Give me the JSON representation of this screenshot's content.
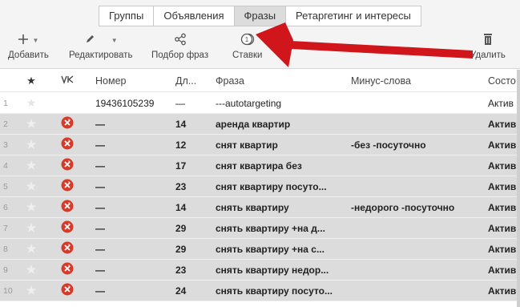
{
  "tabs": [
    {
      "label": "Группы",
      "active": false
    },
    {
      "label": "Объявления",
      "active": false
    },
    {
      "label": "Фразы",
      "active": true
    },
    {
      "label": "Ретаргетинг и интересы",
      "active": false
    }
  ],
  "toolbar": {
    "add_label": "Добавить",
    "edit_label": "Редактировать",
    "phrase_select_label": "Подбор фраз",
    "bids_label": "Ставки",
    "delete_label": "Удалить"
  },
  "columns": {
    "number": "Номер",
    "length": "Дл...",
    "phrase": "Фраза",
    "minus": "Минус-слова",
    "state": "Состо"
  },
  "rows": [
    {
      "n": "1",
      "status": "none",
      "number": "19436105239",
      "len": "—",
      "phrase": "---autotargeting",
      "minus": "",
      "state": "Актив"
    },
    {
      "n": "2",
      "status": "stopped",
      "number": "—",
      "len": "14",
      "phrase": "аренда квартир",
      "minus": "",
      "state": "Актив"
    },
    {
      "n": "3",
      "status": "stopped",
      "number": "—",
      "len": "12",
      "phrase": "снят квартир",
      "minus": "-без -посуточно",
      "state": "Актив"
    },
    {
      "n": "4",
      "status": "stopped",
      "number": "—",
      "len": "17",
      "phrase": "снят квартира без",
      "minus": "",
      "state": "Актив"
    },
    {
      "n": "5",
      "status": "stopped",
      "number": "—",
      "len": "23",
      "phrase": "снят квартиру посуто...",
      "minus": "",
      "state": "Актив"
    },
    {
      "n": "6",
      "status": "stopped",
      "number": "—",
      "len": "14",
      "phrase": "снять квартиру",
      "minus": "-недорого -посуточно",
      "state": "Актив"
    },
    {
      "n": "7",
      "status": "stopped",
      "number": "—",
      "len": "29",
      "phrase": "снять квартиру +на д...",
      "minus": "",
      "state": "Актив"
    },
    {
      "n": "8",
      "status": "stopped",
      "number": "—",
      "len": "29",
      "phrase": "снять квартиру +на с...",
      "minus": "",
      "state": "Актив"
    },
    {
      "n": "9",
      "status": "stopped",
      "number": "—",
      "len": "23",
      "phrase": "снять квартиру недор...",
      "minus": "",
      "state": "Актив"
    },
    {
      "n": "10",
      "status": "stopped",
      "number": "—",
      "len": "24",
      "phrase": "снять квартиру посуто...",
      "minus": "",
      "state": "Актив"
    }
  ],
  "colors": {
    "accent_arrow": "#d0151b",
    "status_icon": "#d63b2a",
    "row_gray": "#dcdcdc"
  }
}
